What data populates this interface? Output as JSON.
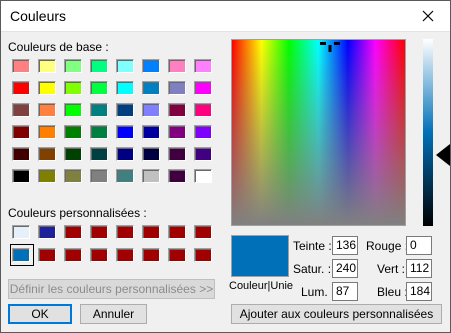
{
  "window": {
    "title": "Couleurs"
  },
  "basic": {
    "label": "Couleurs de base :",
    "colors": [
      "#ff8080",
      "#ffff80",
      "#80ff80",
      "#00ff80",
      "#80ffff",
      "#0080ff",
      "#ff80c0",
      "#ff80ff",
      "#ff0000",
      "#ffff00",
      "#80ff00",
      "#00ff40",
      "#00ffff",
      "#0080c0",
      "#8080c0",
      "#ff00ff",
      "#804040",
      "#ff8040",
      "#00ff00",
      "#008080",
      "#004080",
      "#8080ff",
      "#800040",
      "#ff0080",
      "#800000",
      "#ff8000",
      "#008000",
      "#008040",
      "#0000ff",
      "#0000a0",
      "#800080",
      "#8000ff",
      "#400000",
      "#804000",
      "#004000",
      "#004040",
      "#000080",
      "#000040",
      "#400040",
      "#400080",
      "#000000",
      "#808000",
      "#808040",
      "#808080",
      "#408080",
      "#c0c0c0",
      "#400040",
      "#ffffff"
    ]
  },
  "custom": {
    "label": "Couleurs personnalisées :",
    "colors": [
      "#e6f0fa",
      "#20209a",
      "#a00000",
      "#a00000",
      "#a00000",
      "#a00000",
      "#a00000",
      "#a00000",
      "#0070b8",
      "#a00000",
      "#a00000",
      "#a00000",
      "#a00000",
      "#a00000",
      "#a00000",
      "#a00000"
    ],
    "define_label": "Définir les couleurs personnalisées >>"
  },
  "buttons": {
    "ok": "OK",
    "cancel": "Annuler",
    "add": "Ajouter aux couleurs personnalisées"
  },
  "preview": {
    "label": "Couleur|Unie",
    "color": "#0070b8"
  },
  "fields": {
    "hue_label": "Teinte :",
    "hue": "136",
    "sat_label": "Satur. :",
    "sat": "240",
    "lum_label": "Lum. :",
    "lum": "87",
    "red_label": "Rouge :",
    "red": "0",
    "green_label": "Vert :",
    "green": "112",
    "blue_label": "Bleu :",
    "blue": "184"
  }
}
